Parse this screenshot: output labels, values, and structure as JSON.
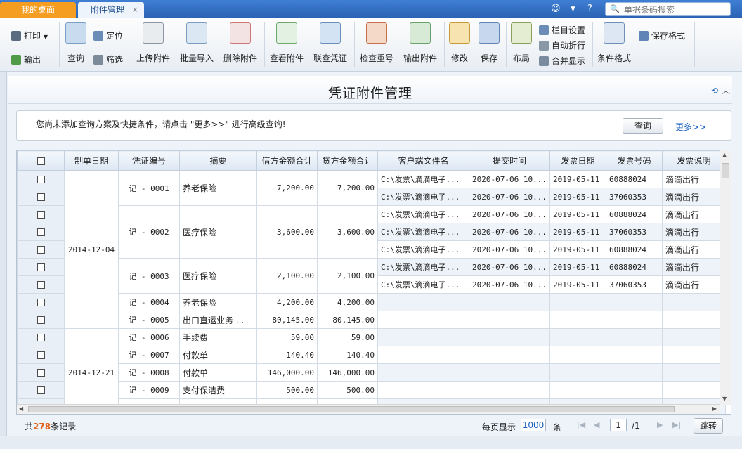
{
  "tabs": {
    "home": "我的桌面",
    "attachments": "附件管理",
    "close": "×"
  },
  "search": {
    "placeholder": "单据条码搜索"
  },
  "toolbar": {
    "print": "打印",
    "export": "输出",
    "query": "查询",
    "locate": "定位",
    "filter": "筛选",
    "upload": "上传附件",
    "batch_import": "批量导入",
    "delete": "删除附件",
    "view": "查看附件",
    "linked_voucher": "联查凭证",
    "check_dup": "检查重号",
    "export_attach": "输出附件",
    "edit": "修改",
    "save": "保存",
    "layout": "布局",
    "column_settings": "栏目设置",
    "auto_wrap": "自动折行",
    "merge_display": "合并显示",
    "cond_format": "条件格式",
    "save_format": "保存格式"
  },
  "page_title": "凭证附件管理",
  "query_panel": {
    "hint": "您尚未添加查询方案及快捷条件，请点击 \"更多>>\" 进行高级查询!",
    "query_button": "查询",
    "more_link": "更多>>"
  },
  "table": {
    "columns": [
      "制单日期",
      "凭证编号",
      "摘要",
      "借方金额合计",
      "贷方金额合计",
      "客户端文件名",
      "提交时间",
      "发票日期",
      "发票号码",
      "发票说明"
    ],
    "groups": [
      {
        "date": "2014-12-04",
        "vouchers": [
          {
            "no": "记 - 0001",
            "summary": "养老保险",
            "debit": "7,200.00",
            "credit": "7,200.00",
            "files": [
              {
                "file": "C:\\发票\\滴滴电子...",
                "submit": "2020-07-06 10...",
                "inv_date": "2019-05-11",
                "inv_no": "60888024",
                "note": "滴滴出行"
              },
              {
                "file": "C:\\发票\\滴滴电子...",
                "submit": "2020-07-06 10...",
                "inv_date": "2019-05-11",
                "inv_no": "37060353",
                "note": "滴滴出行"
              }
            ]
          },
          {
            "no": "记 - 0002",
            "summary": "医疗保险",
            "debit": "3,600.00",
            "credit": "3,600.00",
            "files": [
              {
                "file": "C:\\发票\\滴滴电子...",
                "submit": "2020-07-06 10...",
                "inv_date": "2019-05-11",
                "inv_no": "60888024",
                "note": "滴滴出行"
              },
              {
                "file": "C:\\发票\\滴滴电子...",
                "submit": "2020-07-06 10...",
                "inv_date": "2019-05-11",
                "inv_no": "37060353",
                "note": "滴滴出行"
              },
              {
                "file": "C:\\发票\\滴滴电子...",
                "submit": "2020-07-06 10...",
                "inv_date": "2019-05-11",
                "inv_no": "60888024",
                "note": "滴滴出行"
              }
            ]
          },
          {
            "no": "记 - 0003",
            "summary": "医疗保险",
            "debit": "2,100.00",
            "credit": "2,100.00",
            "files": [
              {
                "file": "C:\\发票\\滴滴电子...",
                "submit": "2020-07-06 10...",
                "inv_date": "2019-05-11",
                "inv_no": "60888024",
                "note": "滴滴出行"
              },
              {
                "file": "C:\\发票\\滴滴电子...",
                "submit": "2020-07-06 10...",
                "inv_date": "2019-05-11",
                "inv_no": "37060353",
                "note": "滴滴出行"
              }
            ]
          },
          {
            "no": "记 - 0004",
            "summary": "养老保险",
            "debit": "4,200.00",
            "credit": "4,200.00",
            "files": []
          },
          {
            "no": "记 - 0005",
            "summary": "出口直运业务 ...",
            "debit": "80,145.00",
            "credit": "80,145.00",
            "files": []
          }
        ]
      },
      {
        "date": "2014-12-21",
        "vouchers": [
          {
            "no": "记 - 0006",
            "summary": "手续费",
            "debit": "59.00",
            "credit": "59.00",
            "files": []
          },
          {
            "no": "记 - 0007",
            "summary": "付款单",
            "debit": "140.40",
            "credit": "140.40",
            "files": []
          },
          {
            "no": "记 - 0008",
            "summary": "付款单",
            "debit": "146,000.00",
            "credit": "146,000.00",
            "files": []
          },
          {
            "no": "记 - 0009",
            "summary": "支付保洁费",
            "debit": "500.00",
            "credit": "500.00",
            "files": []
          },
          {
            "no": "",
            "summary": "",
            "debit": "",
            "credit": "",
            "files": []
          }
        ]
      }
    ]
  },
  "footer": {
    "total_prefix": "共",
    "total_count": "278",
    "total_suffix": "条记录",
    "per_page_label": "每页显示",
    "per_page_value": "1000",
    "per_page_unit": "条",
    "current_page": "1",
    "total_pages": "/1",
    "jump_button": "跳转"
  }
}
